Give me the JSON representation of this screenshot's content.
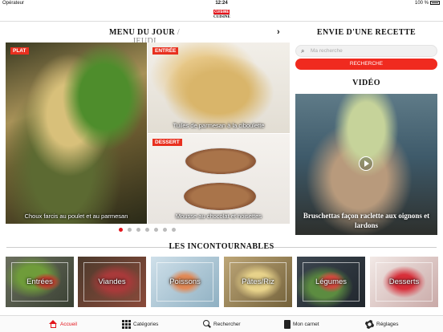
{
  "status_bar": {
    "carrier": "Opérateur",
    "time": "12:24",
    "battery": "100 %"
  },
  "logo": {
    "top": "CUISINE",
    "bottom": "CUISINE"
  },
  "menu": {
    "title": "MENU DU JOUR",
    "day": "/ JEUDI"
  },
  "carousel": {
    "plat": {
      "badge": "PLAT",
      "label": "Choux farcis au poulet et au parmesan"
    },
    "entree": {
      "badge": "ENTRÉE",
      "label": "Tuiles de parmesan à la ciboulette"
    },
    "dessert": {
      "badge": "DESSERT",
      "label": "Mousse au chocolat et noisettes"
    },
    "pages": 7,
    "active_page": 1
  },
  "recipe_search": {
    "title": "ENVIE D'UNE RECETTE",
    "placeholder": "Ma recherche",
    "button": "RECHERCHE"
  },
  "video": {
    "title": "VIDÉO",
    "caption": "Bruschettas façon raclette aux oignons et lardons"
  },
  "incontournables": {
    "title": "LES INCONTOURNABLES",
    "items": [
      "Entrées",
      "Viandes",
      "Poissons",
      "Pâtes/Riz",
      "Légumes",
      "Desserts"
    ]
  },
  "tabbar": {
    "home": "Accueil",
    "categories": "Catégories",
    "search": "Rechercher",
    "notebook": "Mon carnet",
    "settings": "Réglages"
  },
  "colors": {
    "accent": "#e3141b",
    "button": "#f02a1f"
  }
}
